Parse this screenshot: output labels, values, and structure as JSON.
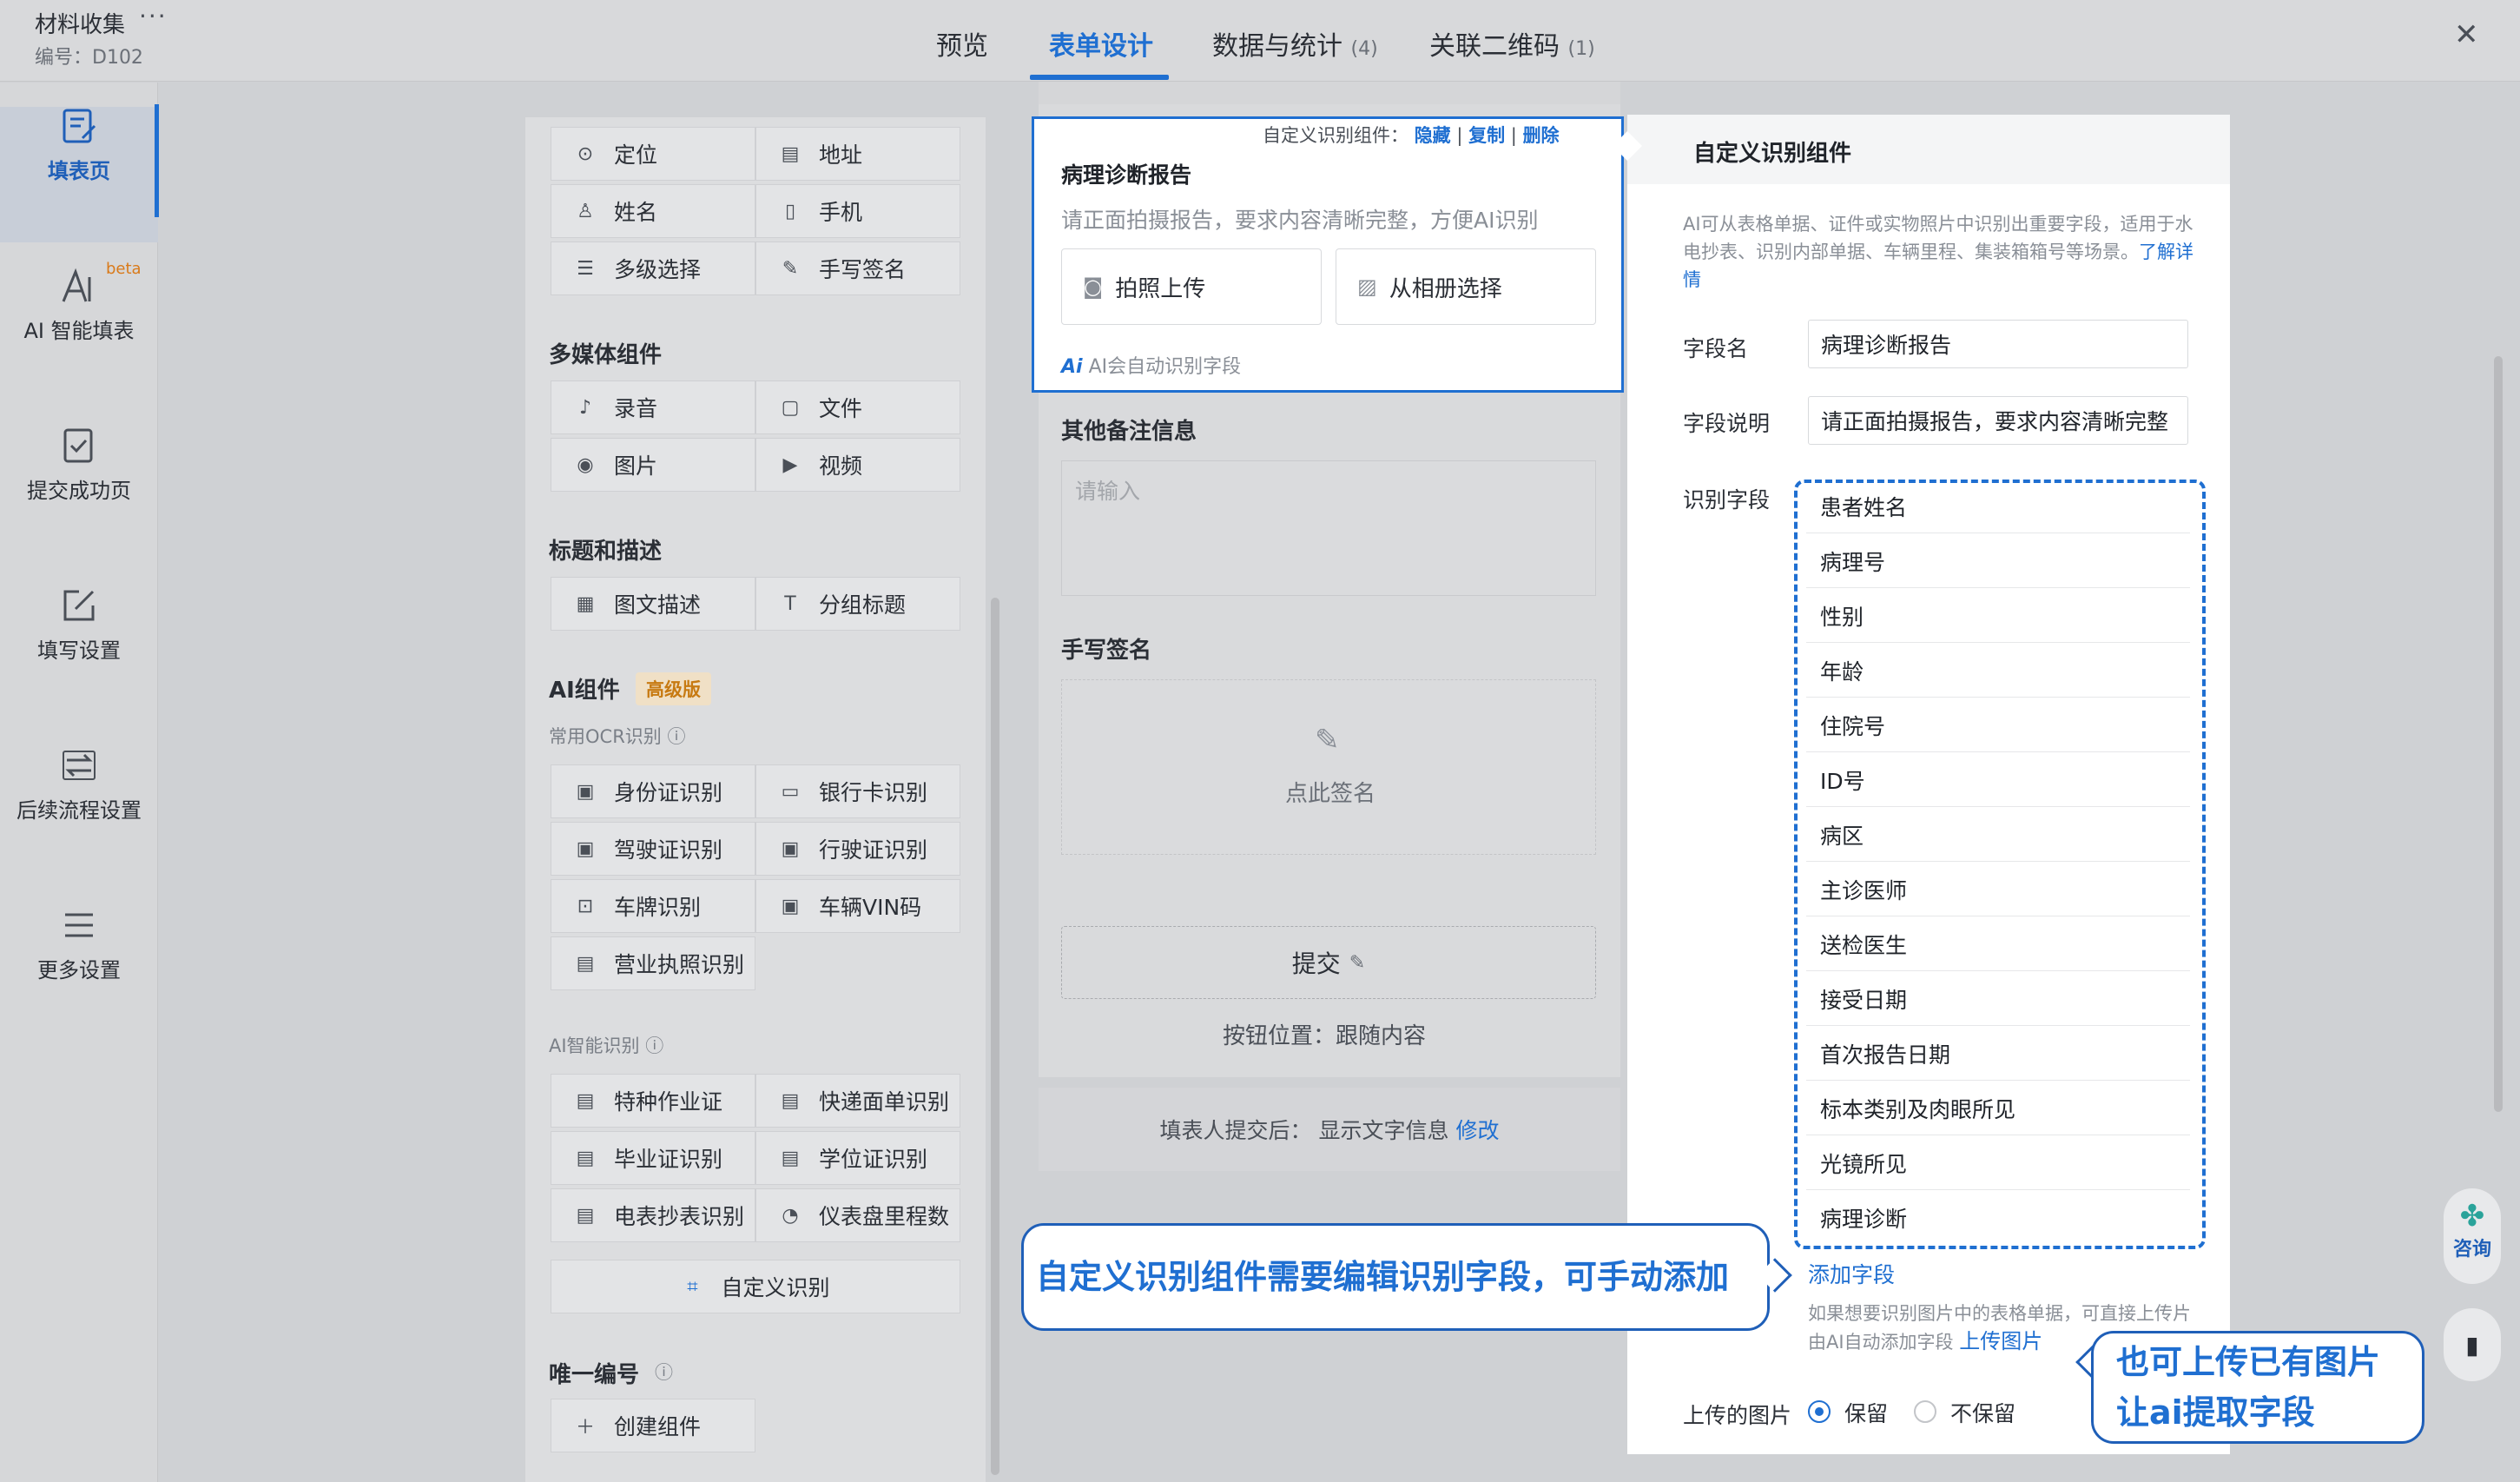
{
  "app": {
    "title": "材料收集",
    "more": "···",
    "code": "编号：D102",
    "close": "✕"
  },
  "tabs": [
    {
      "label": "预览",
      "count": ""
    },
    {
      "label": "表单设计",
      "count": ""
    },
    {
      "label": "数据与统计",
      "count": "(4)"
    },
    {
      "label": "关联二维码",
      "count": "(1)"
    }
  ],
  "nav": [
    {
      "label": "填表页",
      "icon": "form-edit-icon"
    },
    {
      "label": "AI 智能填表",
      "icon": "ai-fill-icon",
      "badge": "beta"
    },
    {
      "label": "提交成功页",
      "icon": "checklist-icon"
    },
    {
      "label": "填写设置",
      "icon": "edit-square-icon"
    },
    {
      "label": "后续流程设置",
      "icon": "loop-icon"
    },
    {
      "label": "更多设置",
      "icon": "menu-icon"
    }
  ],
  "components": {
    "basic": [
      {
        "label": "定位",
        "icon": "location-icon",
        "glyph": "⊙"
      },
      {
        "label": "地址",
        "icon": "address-icon",
        "glyph": "▤"
      },
      {
        "label": "姓名",
        "icon": "person-icon",
        "glyph": "♙"
      },
      {
        "label": "手机",
        "icon": "phone-icon",
        "glyph": "▯"
      },
      {
        "label": "多级选择",
        "icon": "cascade-icon",
        "glyph": "☰"
      },
      {
        "label": "手写签名",
        "icon": "signature-icon",
        "glyph": "✎"
      }
    ],
    "media_title": "多媒体组件",
    "media": [
      {
        "label": "录音",
        "icon": "microphone-icon",
        "glyph": "♪"
      },
      {
        "label": "文件",
        "icon": "file-icon",
        "glyph": "▢"
      },
      {
        "label": "图片",
        "icon": "camera-icon",
        "glyph": "◉"
      },
      {
        "label": "视频",
        "icon": "video-icon",
        "glyph": "▶"
      }
    ],
    "heading_title": "标题和描述",
    "heading": [
      {
        "label": "图文描述",
        "icon": "image-text-icon",
        "glyph": "▦"
      },
      {
        "label": "分组标题",
        "icon": "title-icon",
        "glyph": "T"
      }
    ],
    "ai_title": "AI组件",
    "ai_badge": "高级版",
    "ocr_subtitle": "常用OCR识别 ⓘ",
    "ocr": [
      {
        "label": "身份证识别",
        "icon": "id-card-icon",
        "glyph": "▣"
      },
      {
        "label": "银行卡识别",
        "icon": "bank-card-icon",
        "glyph": "▭"
      },
      {
        "label": "驾驶证识别",
        "icon": "driver-license-icon",
        "glyph": "▣"
      },
      {
        "label": "行驶证识别",
        "icon": "vehicle-license-icon",
        "glyph": "▣"
      },
      {
        "label": "车牌识别",
        "icon": "car-icon",
        "glyph": "⊡"
      },
      {
        "label": "车辆VIN码",
        "icon": "vin-icon",
        "glyph": "▣"
      },
      {
        "label": "营业执照识别",
        "icon": "business-license-icon",
        "glyph": "▤"
      }
    ],
    "ai_subtitle": "AI智能识别 ⓘ",
    "ai": [
      {
        "label": "特种作业证",
        "icon": "certificate-icon",
        "glyph": "▤"
      },
      {
        "label": "快递面单识别",
        "icon": "waybill-icon",
        "glyph": "▤"
      },
      {
        "label": "毕业证识别",
        "icon": "diploma-icon",
        "glyph": "▤"
      },
      {
        "label": "学位证识别",
        "icon": "degree-icon",
        "glyph": "▤"
      },
      {
        "label": "电表抄表识别",
        "icon": "meter-icon",
        "glyph": "▤"
      },
      {
        "label": "仪表盘里程数",
        "icon": "dashboard-icon",
        "glyph": "◔"
      }
    ],
    "custom_ocr": "自定义识别",
    "unique_title": "唯一编号",
    "unique_help": "ⓘ",
    "create_component": "创建组件"
  },
  "form": {
    "toolbar_prefix": "自定义识别组件：",
    "toolbar_hide": "隐藏",
    "toolbar_copy": "复制",
    "toolbar_delete": "删除",
    "ocr_title": "病理诊断报告",
    "ocr_desc": "请正面拍摄报告，要求内容清晰完整，方便AI识别",
    "take_photo": "拍照上传",
    "choose_album": "从相册选择",
    "ai_hint": "AI会自动识别字段",
    "notes_label": "其他备注信息",
    "notes_placeholder": "请输入",
    "sign_label": "手写签名",
    "sign_text": "点此签名",
    "submit": "提交",
    "submit_position": "按钮位置：跟随内容",
    "after_submit": "填表人提交后： 显示文字信息",
    "after_submit_edit": "修改"
  },
  "props": {
    "title": "自定义识别组件",
    "intro": "AI可从表格单据、证件或实物照片中识别出重要字段，适用于水电抄表、识别内部单据、车辆里程、集装箱箱号等场景。",
    "intro_link": "了解详情",
    "field_name_label": "字段名",
    "field_name_value": "病理诊断报告",
    "field_desc_label": "字段说明",
    "field_desc_value": "请正面拍摄报告，要求内容清晰完整",
    "recognize_label": "识别字段",
    "fields": [
      "患者姓名",
      "病理号",
      "性别",
      "年龄",
      "住院号",
      "ID号",
      "病区",
      "主诊医师",
      "送检医生",
      "接受日期",
      "首次报告日期",
      "标本类别及肉眼所见",
      "光镜所见",
      "病理诊断"
    ],
    "add_field": "添加字段",
    "upload_note": "如果想要识别图片中的表格单据，可直接上传片由AI自动添加字段",
    "upload_link": "上传图片",
    "uploaded_label": "上传的图片",
    "keep": "保留",
    "not_keep": "不保留"
  },
  "callouts": {
    "edit_fields": "自定义识别组件需要编辑识别字段，可手动添加",
    "upload_line1": "也可上传已有图片",
    "upload_line2": "让ai提取字段"
  },
  "float": {
    "consult": "咨询",
    "consult_icon": "✤"
  },
  "colors": {
    "accent": "#1f6fd1",
    "badge": "#c77a12"
  }
}
